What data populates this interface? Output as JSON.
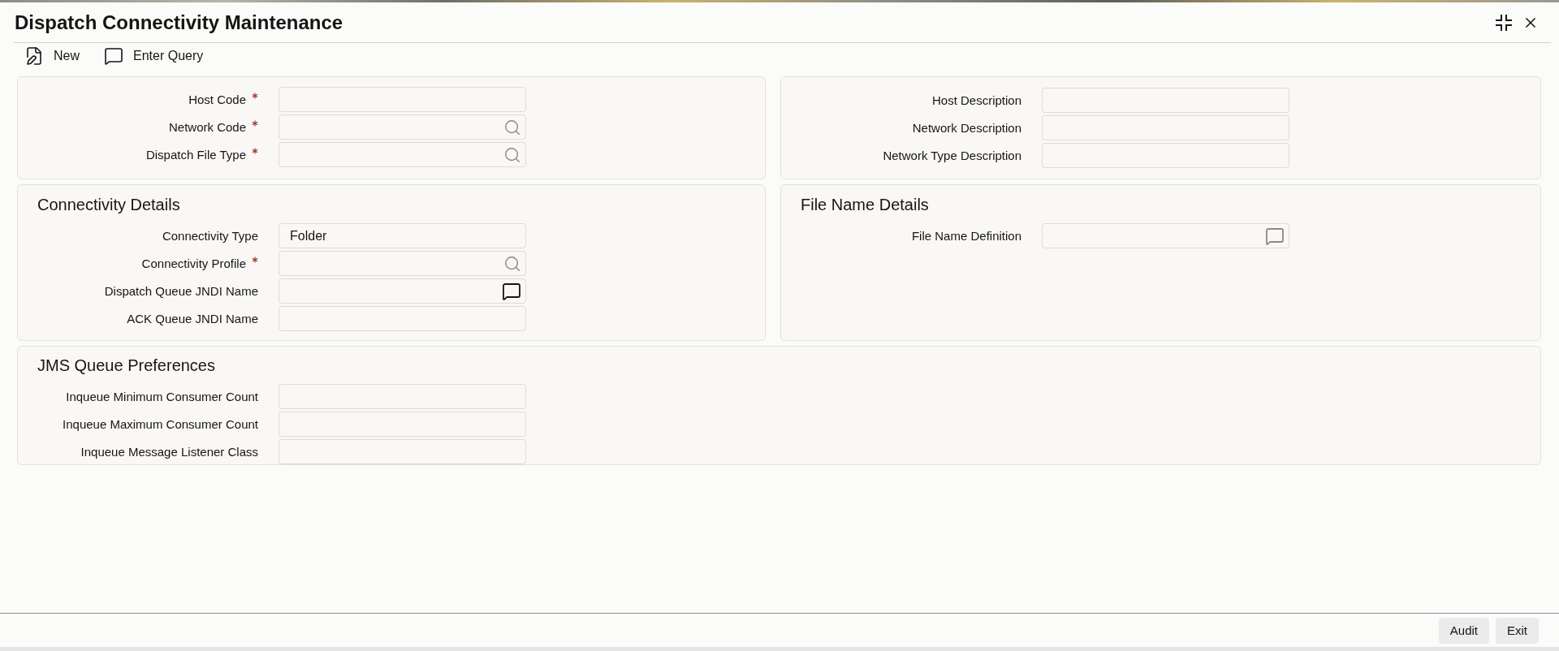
{
  "window": {
    "title": "Dispatch Connectivity Maintenance"
  },
  "toolbar": [
    {
      "label": "New",
      "kind": "new"
    },
    {
      "label": "Enter Query",
      "kind": "query"
    }
  ],
  "host_panel": {
    "fields": [
      {
        "label": "Host Code",
        "required": true,
        "kind": "text"
      },
      {
        "label": "Network Code",
        "required": true,
        "kind": "lookup",
        "icon_active": false
      },
      {
        "label": "Dispatch File Type",
        "required": true,
        "kind": "lookup",
        "icon_active": false
      }
    ]
  },
  "description_panel": {
    "fields": [
      {
        "label": "Host Description",
        "required": false,
        "kind": "text"
      },
      {
        "label": "Network Description",
        "required": false,
        "kind": "text"
      },
      {
        "label": "Network Type Description",
        "required": false,
        "kind": "text"
      }
    ]
  },
  "connectivity_details": {
    "title": "Connectivity Details",
    "fields": [
      {
        "label": "Connectivity Type",
        "required": false,
        "kind": "text",
        "value": "Folder"
      },
      {
        "label": "Connectivity Profile",
        "required": true,
        "kind": "lookup",
        "icon_active": false
      },
      {
        "label": "Dispatch Queue JNDI Name",
        "required": false,
        "kind": "comment",
        "icon_active": true
      },
      {
        "label": "ACK Queue JNDI Name",
        "required": false,
        "kind": "text"
      }
    ]
  },
  "file_name_details": {
    "title": "File Name Details",
    "fields": [
      {
        "label": "File Name Definition",
        "required": false,
        "kind": "comment",
        "icon_active": false
      }
    ]
  },
  "jms_queue_preferences": {
    "title": "JMS Queue Preferences",
    "fields": [
      {
        "label": "Inqueue Minimum Consumer Count",
        "required": false,
        "kind": "text"
      },
      {
        "label": "Inqueue Maximum Consumer Count",
        "required": false,
        "kind": "text"
      },
      {
        "label": "Inqueue Message Listener Class",
        "required": false,
        "kind": "text"
      }
    ]
  },
  "footer": {
    "buttons": [
      "Audit",
      "Exit"
    ]
  }
}
